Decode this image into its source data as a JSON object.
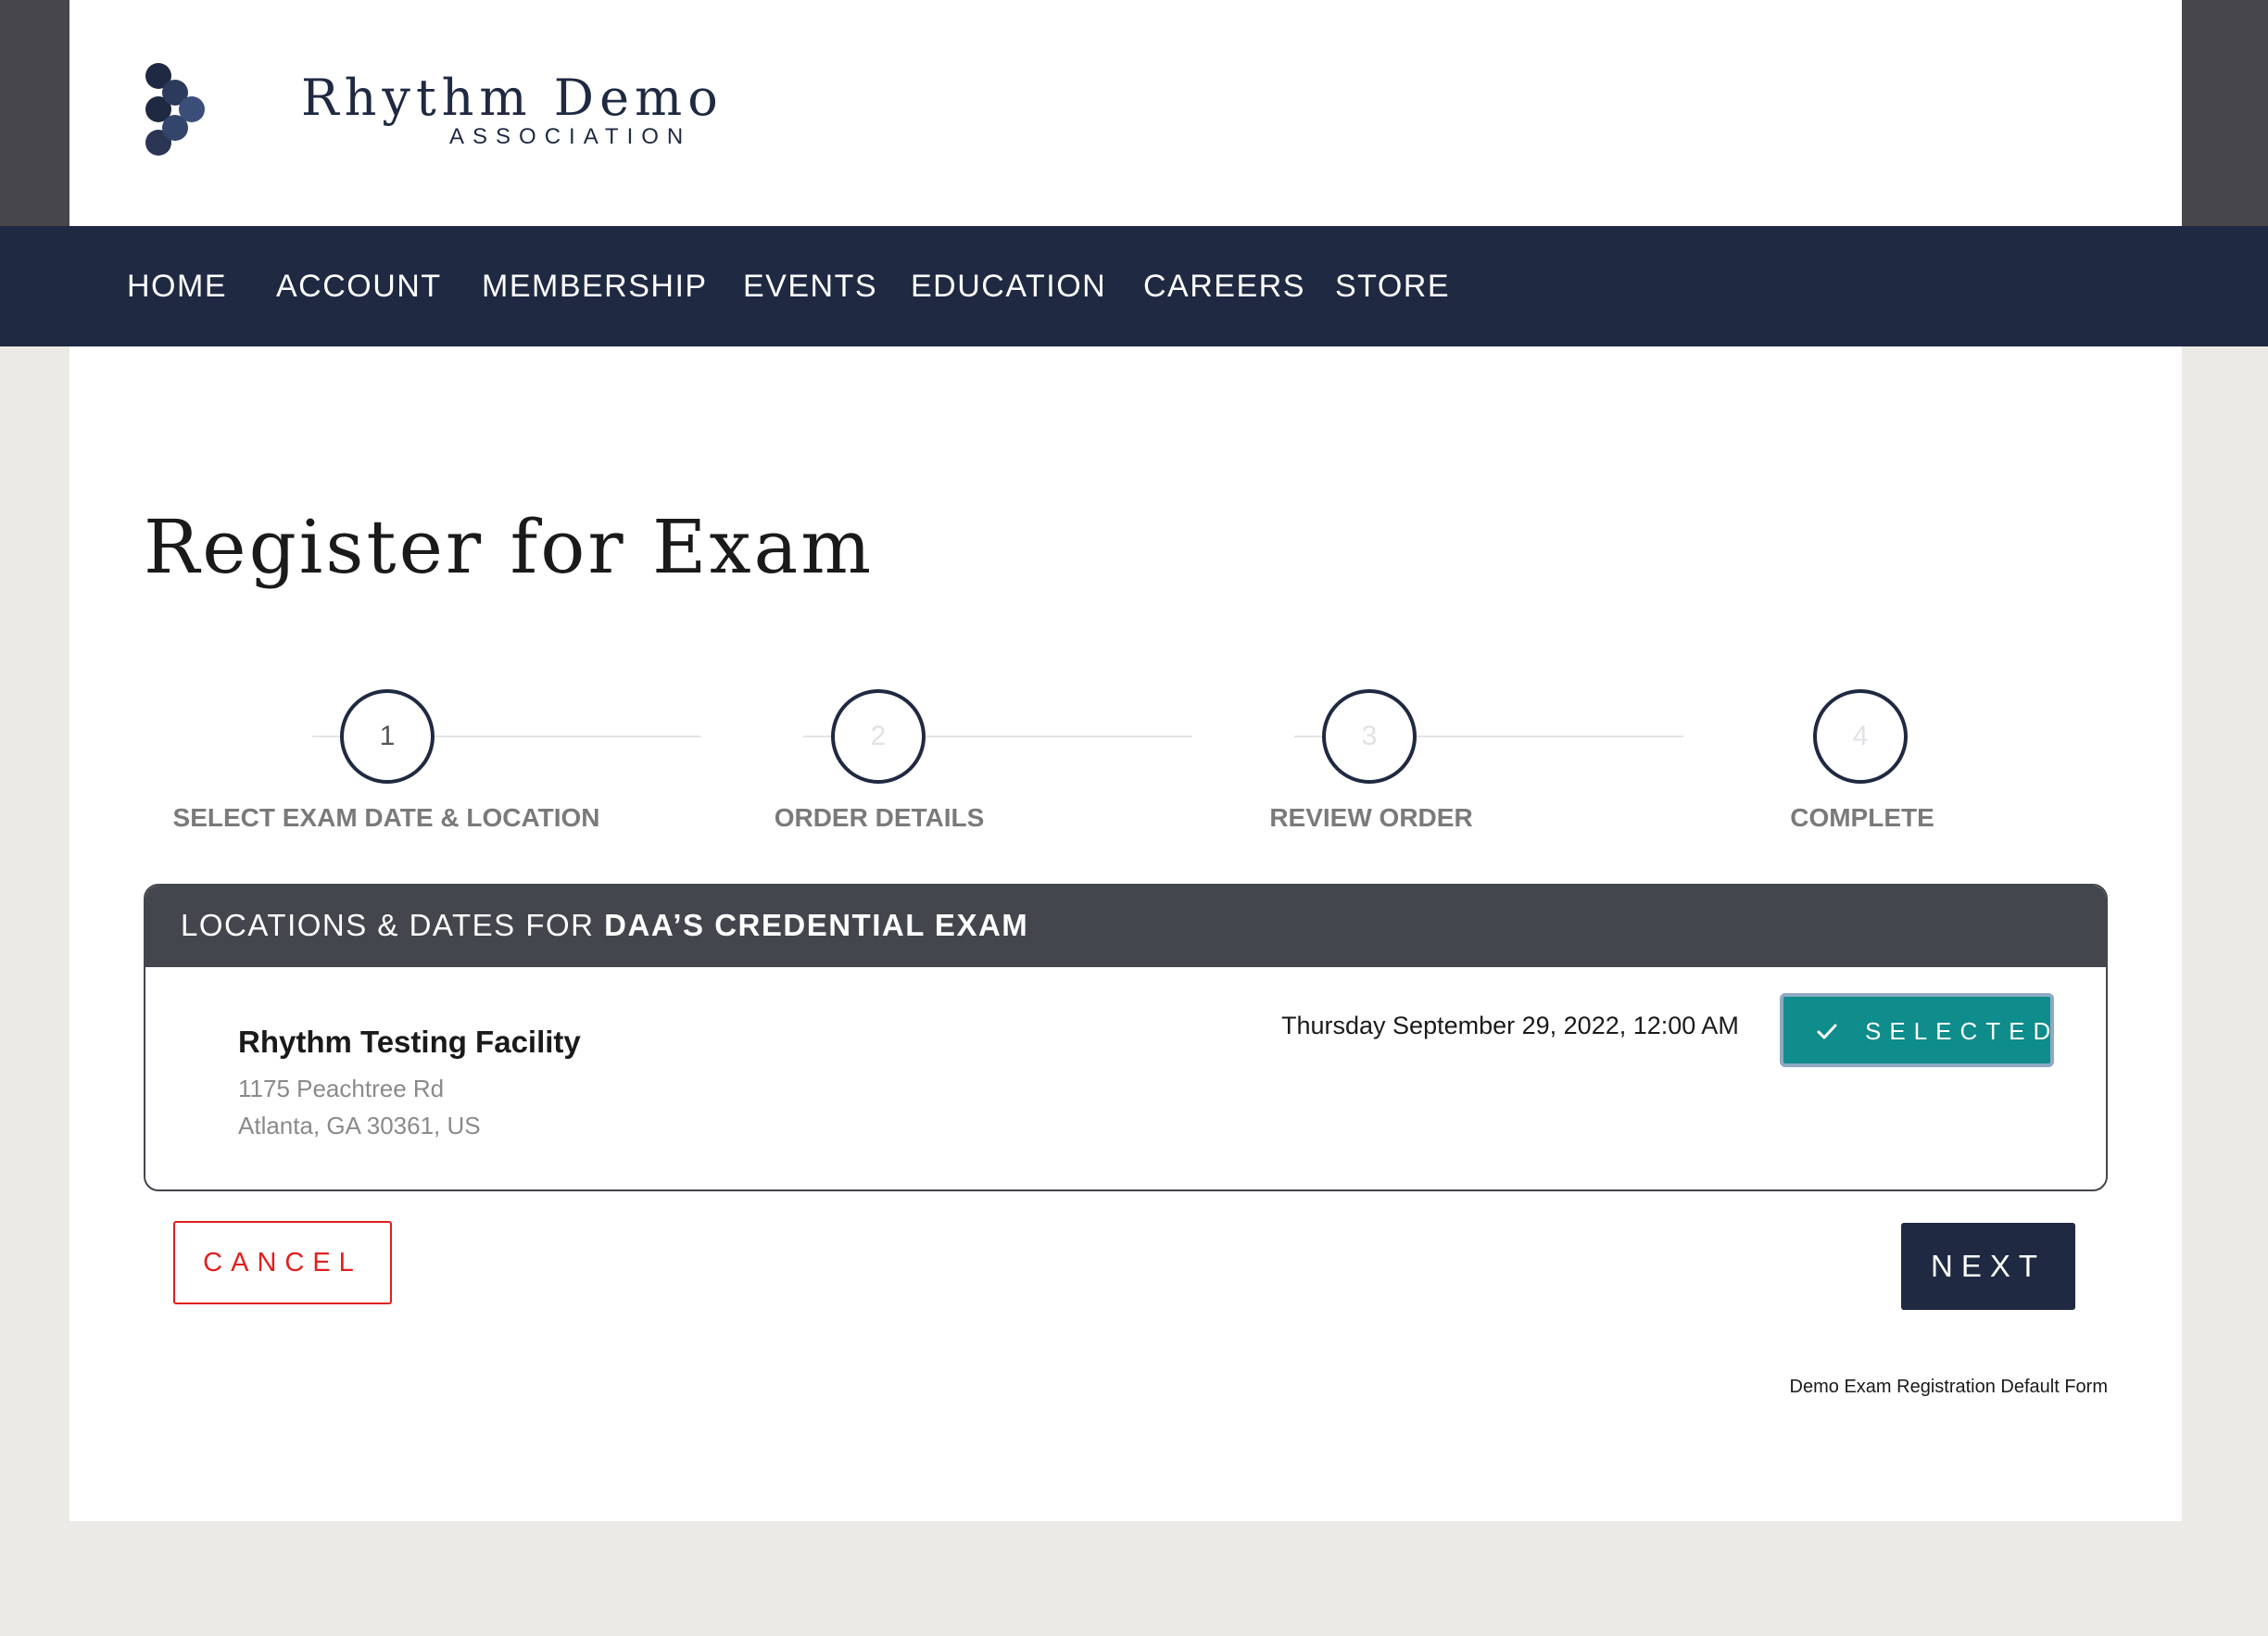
{
  "header": {
    "logo": {
      "name": "Rhythm Demo",
      "sub": "ASSOCIATION"
    }
  },
  "nav": {
    "items": [
      {
        "label": "HOME"
      },
      {
        "label": "ACCOUNT"
      },
      {
        "label": "MEMBERSHIP"
      },
      {
        "label": "EVENTS"
      },
      {
        "label": "EDUCATION"
      },
      {
        "label": "CAREERS"
      },
      {
        "label": "STORE"
      }
    ]
  },
  "main": {
    "title": "Register for Exam",
    "steps": [
      {
        "number": "1",
        "label": "SELECT EXAM DATE & LOCATION",
        "active": true
      },
      {
        "number": "2",
        "label": "ORDER DETAILS",
        "active": false
      },
      {
        "number": "3",
        "label": "REVIEW ORDER",
        "active": false
      },
      {
        "number": "4",
        "label": "COMPLETE",
        "active": false
      }
    ],
    "panel": {
      "heading_prefix": "LOCATIONS & DATES FOR ",
      "heading_exam": "DAA’S CREDENTIAL EXAM",
      "location": {
        "name": "Rhythm Testing Facility",
        "address_line1": "1175 Peachtree Rd",
        "address_line2": "Atlanta, GA 30361, US",
        "date": "Thursday September 29, 2022, 12:00 AM",
        "selected_label": "SELECTED"
      }
    },
    "actions": {
      "cancel_label": "CANCEL",
      "next_label": "NEXT"
    },
    "form_name": "Demo Exam Registration Default Form"
  },
  "colors": {
    "navy": "#1f2942",
    "panel_header": "#43464c",
    "teal": "#0f8c8c",
    "danger": "#e0201e",
    "page_bg": "#ebeae6"
  }
}
